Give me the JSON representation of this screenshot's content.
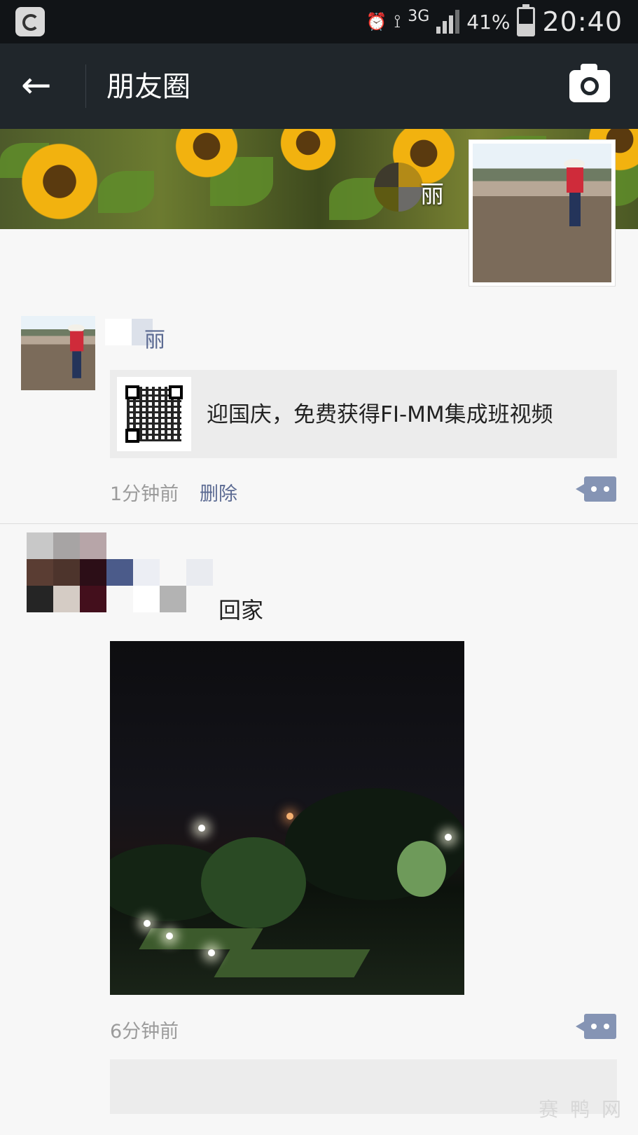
{
  "status_bar": {
    "wifi_label": "3G",
    "battery_percent": "41%",
    "clock": "20:40",
    "icons": [
      "app-icon",
      "alarm-icon",
      "wifi-icon",
      "signal-icon",
      "battery-icon"
    ]
  },
  "navbar": {
    "back_icon": "←",
    "title": "朋友圈",
    "camera_icon": "camera-icon"
  },
  "cover": {
    "name": "丽"
  },
  "posts": [
    {
      "author": "丽",
      "link_title": "迎国庆，免费获得FI-MM集成班视频",
      "time": "1分钟前",
      "delete_label": "删除"
    },
    {
      "text": "回家",
      "time": "6分钟前"
    }
  ],
  "watermark": "赛 鸭 网",
  "colors": {
    "navbar_bg": "#20262b",
    "status_bg": "#111417",
    "page_bg": "#f7f7f7",
    "link_blue": "#5b6a92",
    "comment_button": "#8594b4"
  }
}
